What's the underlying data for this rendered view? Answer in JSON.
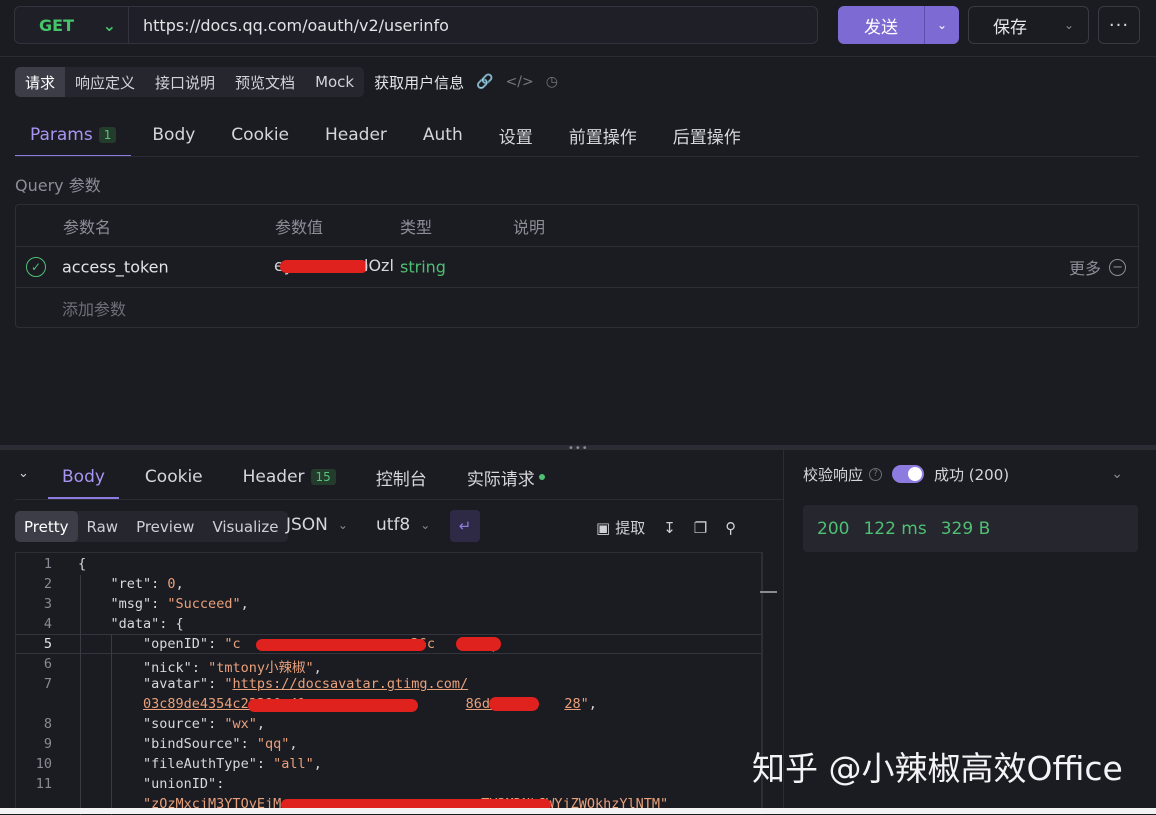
{
  "request": {
    "method": "GET",
    "url": "https://docs.qq.com/oauth/v2/userinfo",
    "send_label": "发送",
    "save_label": "保存",
    "more_label": "···"
  },
  "subtabs": [
    "请求",
    "响应定义",
    "接口说明",
    "预览文档",
    "Mock"
  ],
  "api_name": "获取用户信息",
  "main_tabs": {
    "params": "Params",
    "params_count": "1",
    "body": "Body",
    "cookie": "Cookie",
    "header": "Header",
    "auth": "Auth",
    "settings": "设置",
    "pre": "前置操作",
    "post": "后置操作"
  },
  "query": {
    "label": "Query 参数",
    "columns": [
      "参数名",
      "参数值",
      "类型",
      "说明"
    ],
    "param_name": "access_token",
    "param_value_visible": "ey",
    "param_value_tail": "lOzl",
    "param_type": "string",
    "more_label": "更多",
    "add_label": "添加参数"
  },
  "response_tabs": {
    "body": "Body",
    "cookie": "Cookie",
    "header": "Header",
    "header_count": "15",
    "console": "控制台",
    "actual": "实际请求"
  },
  "format": {
    "tabs": [
      "Pretty",
      "Raw",
      "Preview",
      "Visualize"
    ],
    "type": "JSON",
    "encoding": "utf8",
    "extract_label": "提取"
  },
  "code": {
    "line_numbers": [
      "1",
      "2",
      "3",
      "4",
      "5",
      "6",
      "7",
      "",
      "8",
      "9",
      "10",
      "11",
      ""
    ],
    "l1": "{",
    "ret_key": "\"ret\"",
    "ret_val": "0",
    "msg_key": "\"msg\"",
    "msg_val": "\"Succeed\"",
    "data_key": "\"data\"",
    "openid_key": "\"openID\"",
    "openid_val_start": "\"c",
    "openid_val_end": "36c",
    "nick_key": "\"nick\"",
    "nick_val": "\"tmtony小辣椒\"",
    "avatar_key": "\"avatar\"",
    "avatar_val1": "https://docsavatar.gtimg.com/",
    "avatar_val2_start": "03c89de4354c23390a41",
    "avatar_val2_mid": "86d/10",
    "avatar_val2_end": "28",
    "source_key": "\"source\"",
    "source_val": "\"wx\"",
    "bind_key": "\"bindSource\"",
    "bind_val": "\"qq\"",
    "fileauth_key": "\"fileAuthType\"",
    "fileauth_val": "\"all\"",
    "union_key": "\"unionID\"",
    "union_val_start": "\"zOzMxcjM3YTOyEjM",
    "union_val_end": "TY3MDNkJWYjZWOkhzYlNTM\""
  },
  "validation": {
    "label": "校验响应",
    "result": "成功 (200)"
  },
  "status": {
    "code": "200",
    "time": "122 ms",
    "size": "329 B"
  },
  "watermark": "知乎 @小辣椒高效Office"
}
